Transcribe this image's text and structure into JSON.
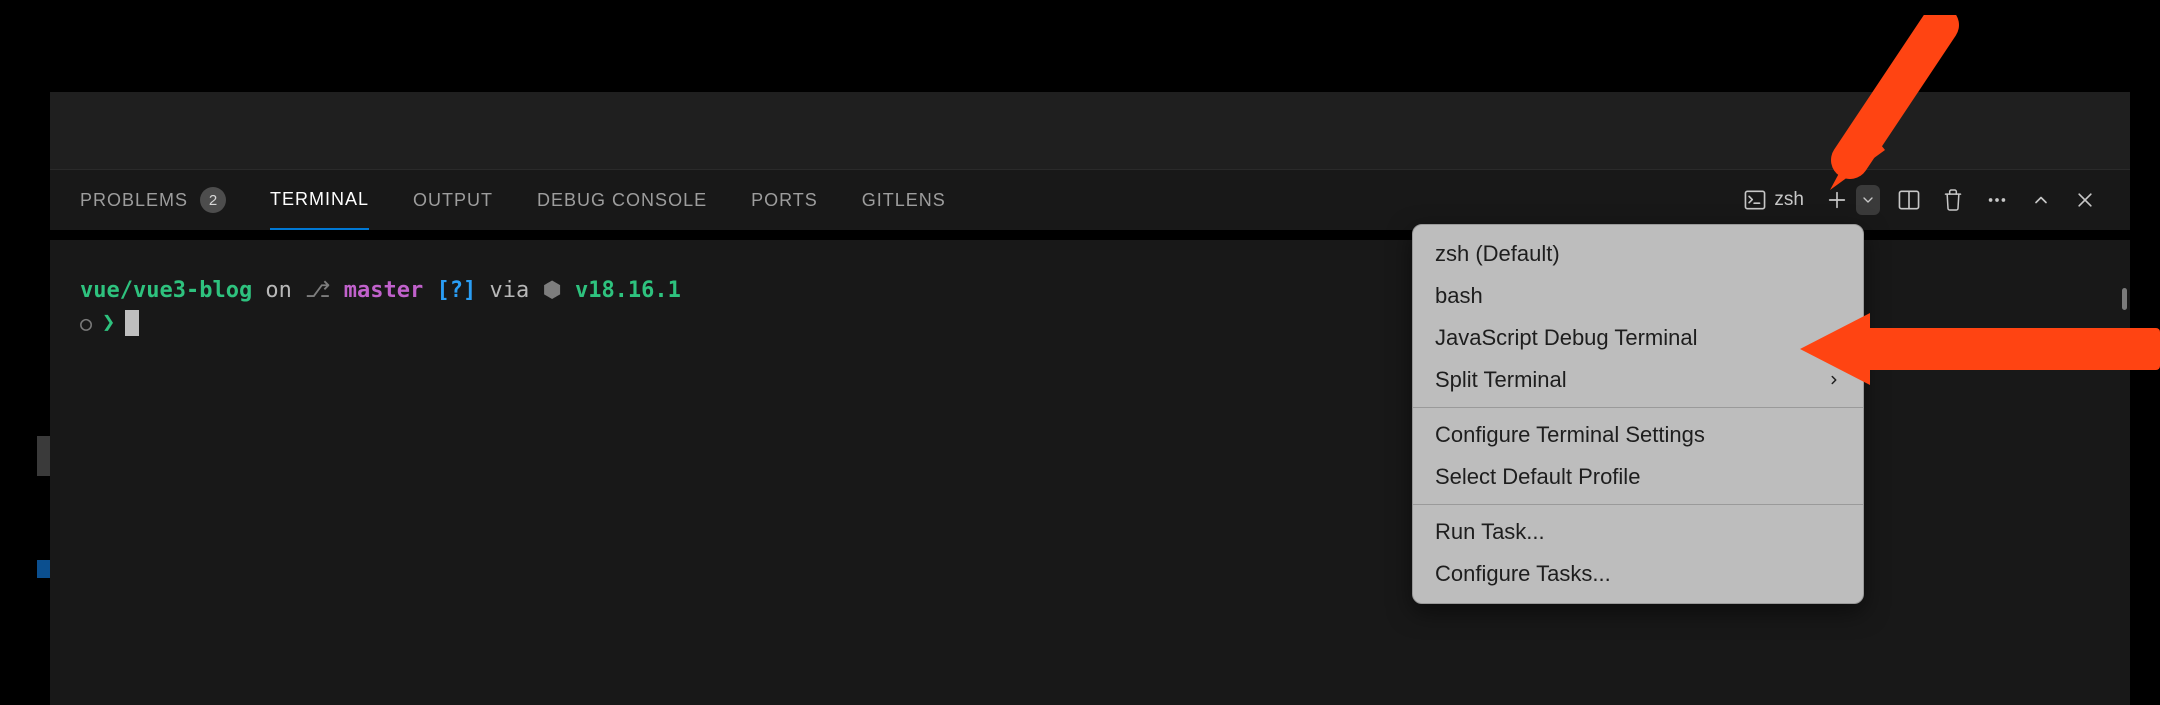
{
  "tabs": {
    "problems": "PROBLEMS",
    "problems_badge": "2",
    "terminal": "TERMINAL",
    "output": "OUTPUT",
    "debug_console": "DEBUG CONSOLE",
    "ports": "PORTS",
    "gitlens": "GITLENS"
  },
  "toolbar": {
    "shell_name": "zsh"
  },
  "prompt": {
    "path": "vue/vue3-blog",
    "on": " on ",
    "gitbox": "⎇",
    "branch": " master ",
    "flag": "[?]",
    "via": " via ",
    "nodebox": "⬢",
    "nodever": " v18.16.1",
    "circle": "○",
    "arrow": "❯"
  },
  "menu": {
    "zsh_default": "zsh (Default)",
    "bash": "bash",
    "js_debug": "JavaScript Debug Terminal",
    "split": "Split Terminal",
    "configure_settings": "Configure Terminal Settings",
    "select_profile": "Select Default Profile",
    "run_task": "Run Task...",
    "configure_tasks": "Configure Tasks..."
  }
}
